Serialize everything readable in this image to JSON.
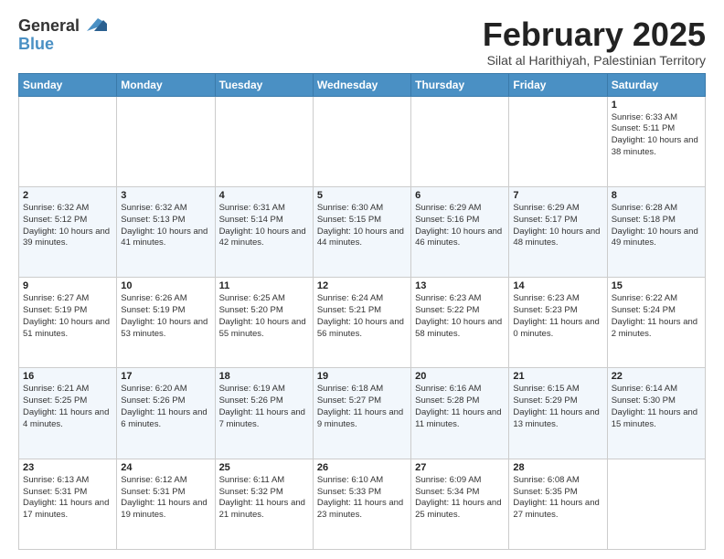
{
  "header": {
    "logo_general": "General",
    "logo_blue": "Blue",
    "month_title": "February 2025",
    "location": "Silat al Harithiyah, Palestinian Territory"
  },
  "days_of_week": [
    "Sunday",
    "Monday",
    "Tuesday",
    "Wednesday",
    "Thursday",
    "Friday",
    "Saturday"
  ],
  "weeks": [
    {
      "cells": [
        {
          "day": "",
          "content": ""
        },
        {
          "day": "",
          "content": ""
        },
        {
          "day": "",
          "content": ""
        },
        {
          "day": "",
          "content": ""
        },
        {
          "day": "",
          "content": ""
        },
        {
          "day": "",
          "content": ""
        },
        {
          "day": "1",
          "content": "Sunrise: 6:33 AM\nSunset: 5:11 PM\nDaylight: 10 hours\nand 38 minutes."
        }
      ]
    },
    {
      "cells": [
        {
          "day": "2",
          "content": "Sunrise: 6:32 AM\nSunset: 5:12 PM\nDaylight: 10 hours\nand 39 minutes."
        },
        {
          "day": "3",
          "content": "Sunrise: 6:32 AM\nSunset: 5:13 PM\nDaylight: 10 hours\nand 41 minutes."
        },
        {
          "day": "4",
          "content": "Sunrise: 6:31 AM\nSunset: 5:14 PM\nDaylight: 10 hours\nand 42 minutes."
        },
        {
          "day": "5",
          "content": "Sunrise: 6:30 AM\nSunset: 5:15 PM\nDaylight: 10 hours\nand 44 minutes."
        },
        {
          "day": "6",
          "content": "Sunrise: 6:29 AM\nSunset: 5:16 PM\nDaylight: 10 hours\nand 46 minutes."
        },
        {
          "day": "7",
          "content": "Sunrise: 6:29 AM\nSunset: 5:17 PM\nDaylight: 10 hours\nand 48 minutes."
        },
        {
          "day": "8",
          "content": "Sunrise: 6:28 AM\nSunset: 5:18 PM\nDaylight: 10 hours\nand 49 minutes."
        }
      ]
    },
    {
      "cells": [
        {
          "day": "9",
          "content": "Sunrise: 6:27 AM\nSunset: 5:19 PM\nDaylight: 10 hours\nand 51 minutes."
        },
        {
          "day": "10",
          "content": "Sunrise: 6:26 AM\nSunset: 5:19 PM\nDaylight: 10 hours\nand 53 minutes."
        },
        {
          "day": "11",
          "content": "Sunrise: 6:25 AM\nSunset: 5:20 PM\nDaylight: 10 hours\nand 55 minutes."
        },
        {
          "day": "12",
          "content": "Sunrise: 6:24 AM\nSunset: 5:21 PM\nDaylight: 10 hours\nand 56 minutes."
        },
        {
          "day": "13",
          "content": "Sunrise: 6:23 AM\nSunset: 5:22 PM\nDaylight: 10 hours\nand 58 minutes."
        },
        {
          "day": "14",
          "content": "Sunrise: 6:23 AM\nSunset: 5:23 PM\nDaylight: 11 hours\nand 0 minutes."
        },
        {
          "day": "15",
          "content": "Sunrise: 6:22 AM\nSunset: 5:24 PM\nDaylight: 11 hours\nand 2 minutes."
        }
      ]
    },
    {
      "cells": [
        {
          "day": "16",
          "content": "Sunrise: 6:21 AM\nSunset: 5:25 PM\nDaylight: 11 hours\nand 4 minutes."
        },
        {
          "day": "17",
          "content": "Sunrise: 6:20 AM\nSunset: 5:26 PM\nDaylight: 11 hours\nand 6 minutes."
        },
        {
          "day": "18",
          "content": "Sunrise: 6:19 AM\nSunset: 5:26 PM\nDaylight: 11 hours\nand 7 minutes."
        },
        {
          "day": "19",
          "content": "Sunrise: 6:18 AM\nSunset: 5:27 PM\nDaylight: 11 hours\nand 9 minutes."
        },
        {
          "day": "20",
          "content": "Sunrise: 6:16 AM\nSunset: 5:28 PM\nDaylight: 11 hours\nand 11 minutes."
        },
        {
          "day": "21",
          "content": "Sunrise: 6:15 AM\nSunset: 5:29 PM\nDaylight: 11 hours\nand 13 minutes."
        },
        {
          "day": "22",
          "content": "Sunrise: 6:14 AM\nSunset: 5:30 PM\nDaylight: 11 hours\nand 15 minutes."
        }
      ]
    },
    {
      "cells": [
        {
          "day": "23",
          "content": "Sunrise: 6:13 AM\nSunset: 5:31 PM\nDaylight: 11 hours\nand 17 minutes."
        },
        {
          "day": "24",
          "content": "Sunrise: 6:12 AM\nSunset: 5:31 PM\nDaylight: 11 hours\nand 19 minutes."
        },
        {
          "day": "25",
          "content": "Sunrise: 6:11 AM\nSunset: 5:32 PM\nDaylight: 11 hours\nand 21 minutes."
        },
        {
          "day": "26",
          "content": "Sunrise: 6:10 AM\nSunset: 5:33 PM\nDaylight: 11 hours\nand 23 minutes."
        },
        {
          "day": "27",
          "content": "Sunrise: 6:09 AM\nSunset: 5:34 PM\nDaylight: 11 hours\nand 25 minutes."
        },
        {
          "day": "28",
          "content": "Sunrise: 6:08 AM\nSunset: 5:35 PM\nDaylight: 11 hours\nand 27 minutes."
        },
        {
          "day": "",
          "content": ""
        }
      ]
    }
  ]
}
